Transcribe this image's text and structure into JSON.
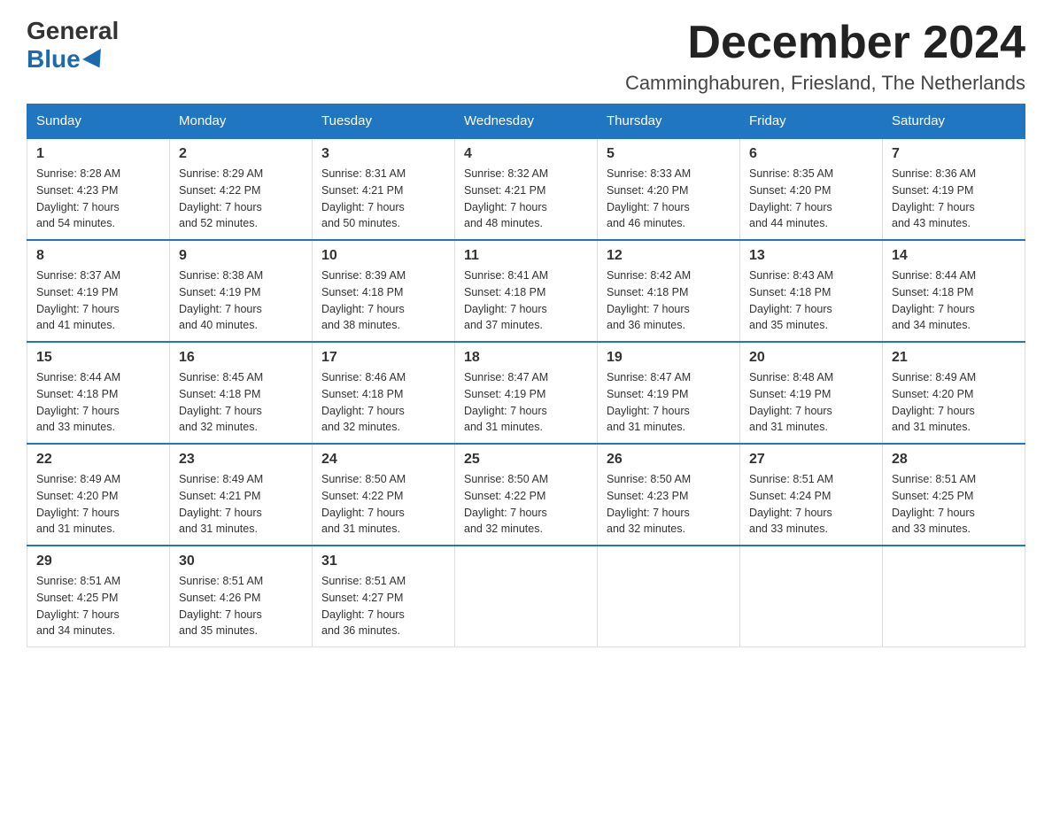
{
  "logo": {
    "general": "General",
    "blue": "Blue"
  },
  "title": {
    "month": "December 2024",
    "location": "Camminghaburen, Friesland, The Netherlands"
  },
  "days_of_week": [
    "Sunday",
    "Monday",
    "Tuesday",
    "Wednesday",
    "Thursday",
    "Friday",
    "Saturday"
  ],
  "weeks": [
    [
      {
        "day": "1",
        "sunrise": "Sunrise: 8:28 AM",
        "sunset": "Sunset: 4:23 PM",
        "daylight": "Daylight: 7 hours",
        "minutes": "and 54 minutes."
      },
      {
        "day": "2",
        "sunrise": "Sunrise: 8:29 AM",
        "sunset": "Sunset: 4:22 PM",
        "daylight": "Daylight: 7 hours",
        "minutes": "and 52 minutes."
      },
      {
        "day": "3",
        "sunrise": "Sunrise: 8:31 AM",
        "sunset": "Sunset: 4:21 PM",
        "daylight": "Daylight: 7 hours",
        "minutes": "and 50 minutes."
      },
      {
        "day": "4",
        "sunrise": "Sunrise: 8:32 AM",
        "sunset": "Sunset: 4:21 PM",
        "daylight": "Daylight: 7 hours",
        "minutes": "and 48 minutes."
      },
      {
        "day": "5",
        "sunrise": "Sunrise: 8:33 AM",
        "sunset": "Sunset: 4:20 PM",
        "daylight": "Daylight: 7 hours",
        "minutes": "and 46 minutes."
      },
      {
        "day": "6",
        "sunrise": "Sunrise: 8:35 AM",
        "sunset": "Sunset: 4:20 PM",
        "daylight": "Daylight: 7 hours",
        "minutes": "and 44 minutes."
      },
      {
        "day": "7",
        "sunrise": "Sunrise: 8:36 AM",
        "sunset": "Sunset: 4:19 PM",
        "daylight": "Daylight: 7 hours",
        "minutes": "and 43 minutes."
      }
    ],
    [
      {
        "day": "8",
        "sunrise": "Sunrise: 8:37 AM",
        "sunset": "Sunset: 4:19 PM",
        "daylight": "Daylight: 7 hours",
        "minutes": "and 41 minutes."
      },
      {
        "day": "9",
        "sunrise": "Sunrise: 8:38 AM",
        "sunset": "Sunset: 4:19 PM",
        "daylight": "Daylight: 7 hours",
        "minutes": "and 40 minutes."
      },
      {
        "day": "10",
        "sunrise": "Sunrise: 8:39 AM",
        "sunset": "Sunset: 4:18 PM",
        "daylight": "Daylight: 7 hours",
        "minutes": "and 38 minutes."
      },
      {
        "day": "11",
        "sunrise": "Sunrise: 8:41 AM",
        "sunset": "Sunset: 4:18 PM",
        "daylight": "Daylight: 7 hours",
        "minutes": "and 37 minutes."
      },
      {
        "day": "12",
        "sunrise": "Sunrise: 8:42 AM",
        "sunset": "Sunset: 4:18 PM",
        "daylight": "Daylight: 7 hours",
        "minutes": "and 36 minutes."
      },
      {
        "day": "13",
        "sunrise": "Sunrise: 8:43 AM",
        "sunset": "Sunset: 4:18 PM",
        "daylight": "Daylight: 7 hours",
        "minutes": "and 35 minutes."
      },
      {
        "day": "14",
        "sunrise": "Sunrise: 8:44 AM",
        "sunset": "Sunset: 4:18 PM",
        "daylight": "Daylight: 7 hours",
        "minutes": "and 34 minutes."
      }
    ],
    [
      {
        "day": "15",
        "sunrise": "Sunrise: 8:44 AM",
        "sunset": "Sunset: 4:18 PM",
        "daylight": "Daylight: 7 hours",
        "minutes": "and 33 minutes."
      },
      {
        "day": "16",
        "sunrise": "Sunrise: 8:45 AM",
        "sunset": "Sunset: 4:18 PM",
        "daylight": "Daylight: 7 hours",
        "minutes": "and 32 minutes."
      },
      {
        "day": "17",
        "sunrise": "Sunrise: 8:46 AM",
        "sunset": "Sunset: 4:18 PM",
        "daylight": "Daylight: 7 hours",
        "minutes": "and 32 minutes."
      },
      {
        "day": "18",
        "sunrise": "Sunrise: 8:47 AM",
        "sunset": "Sunset: 4:19 PM",
        "daylight": "Daylight: 7 hours",
        "minutes": "and 31 minutes."
      },
      {
        "day": "19",
        "sunrise": "Sunrise: 8:47 AM",
        "sunset": "Sunset: 4:19 PM",
        "daylight": "Daylight: 7 hours",
        "minutes": "and 31 minutes."
      },
      {
        "day": "20",
        "sunrise": "Sunrise: 8:48 AM",
        "sunset": "Sunset: 4:19 PM",
        "daylight": "Daylight: 7 hours",
        "minutes": "and 31 minutes."
      },
      {
        "day": "21",
        "sunrise": "Sunrise: 8:49 AM",
        "sunset": "Sunset: 4:20 PM",
        "daylight": "Daylight: 7 hours",
        "minutes": "and 31 minutes."
      }
    ],
    [
      {
        "day": "22",
        "sunrise": "Sunrise: 8:49 AM",
        "sunset": "Sunset: 4:20 PM",
        "daylight": "Daylight: 7 hours",
        "minutes": "and 31 minutes."
      },
      {
        "day": "23",
        "sunrise": "Sunrise: 8:49 AM",
        "sunset": "Sunset: 4:21 PM",
        "daylight": "Daylight: 7 hours",
        "minutes": "and 31 minutes."
      },
      {
        "day": "24",
        "sunrise": "Sunrise: 8:50 AM",
        "sunset": "Sunset: 4:22 PM",
        "daylight": "Daylight: 7 hours",
        "minutes": "and 31 minutes."
      },
      {
        "day": "25",
        "sunrise": "Sunrise: 8:50 AM",
        "sunset": "Sunset: 4:22 PM",
        "daylight": "Daylight: 7 hours",
        "minutes": "and 32 minutes."
      },
      {
        "day": "26",
        "sunrise": "Sunrise: 8:50 AM",
        "sunset": "Sunset: 4:23 PM",
        "daylight": "Daylight: 7 hours",
        "minutes": "and 32 minutes."
      },
      {
        "day": "27",
        "sunrise": "Sunrise: 8:51 AM",
        "sunset": "Sunset: 4:24 PM",
        "daylight": "Daylight: 7 hours",
        "minutes": "and 33 minutes."
      },
      {
        "day": "28",
        "sunrise": "Sunrise: 8:51 AM",
        "sunset": "Sunset: 4:25 PM",
        "daylight": "Daylight: 7 hours",
        "minutes": "and 33 minutes."
      }
    ],
    [
      {
        "day": "29",
        "sunrise": "Sunrise: 8:51 AM",
        "sunset": "Sunset: 4:25 PM",
        "daylight": "Daylight: 7 hours",
        "minutes": "and 34 minutes."
      },
      {
        "day": "30",
        "sunrise": "Sunrise: 8:51 AM",
        "sunset": "Sunset: 4:26 PM",
        "daylight": "Daylight: 7 hours",
        "minutes": "and 35 minutes."
      },
      {
        "day": "31",
        "sunrise": "Sunrise: 8:51 AM",
        "sunset": "Sunset: 4:27 PM",
        "daylight": "Daylight: 7 hours",
        "minutes": "and 36 minutes."
      },
      null,
      null,
      null,
      null
    ]
  ]
}
